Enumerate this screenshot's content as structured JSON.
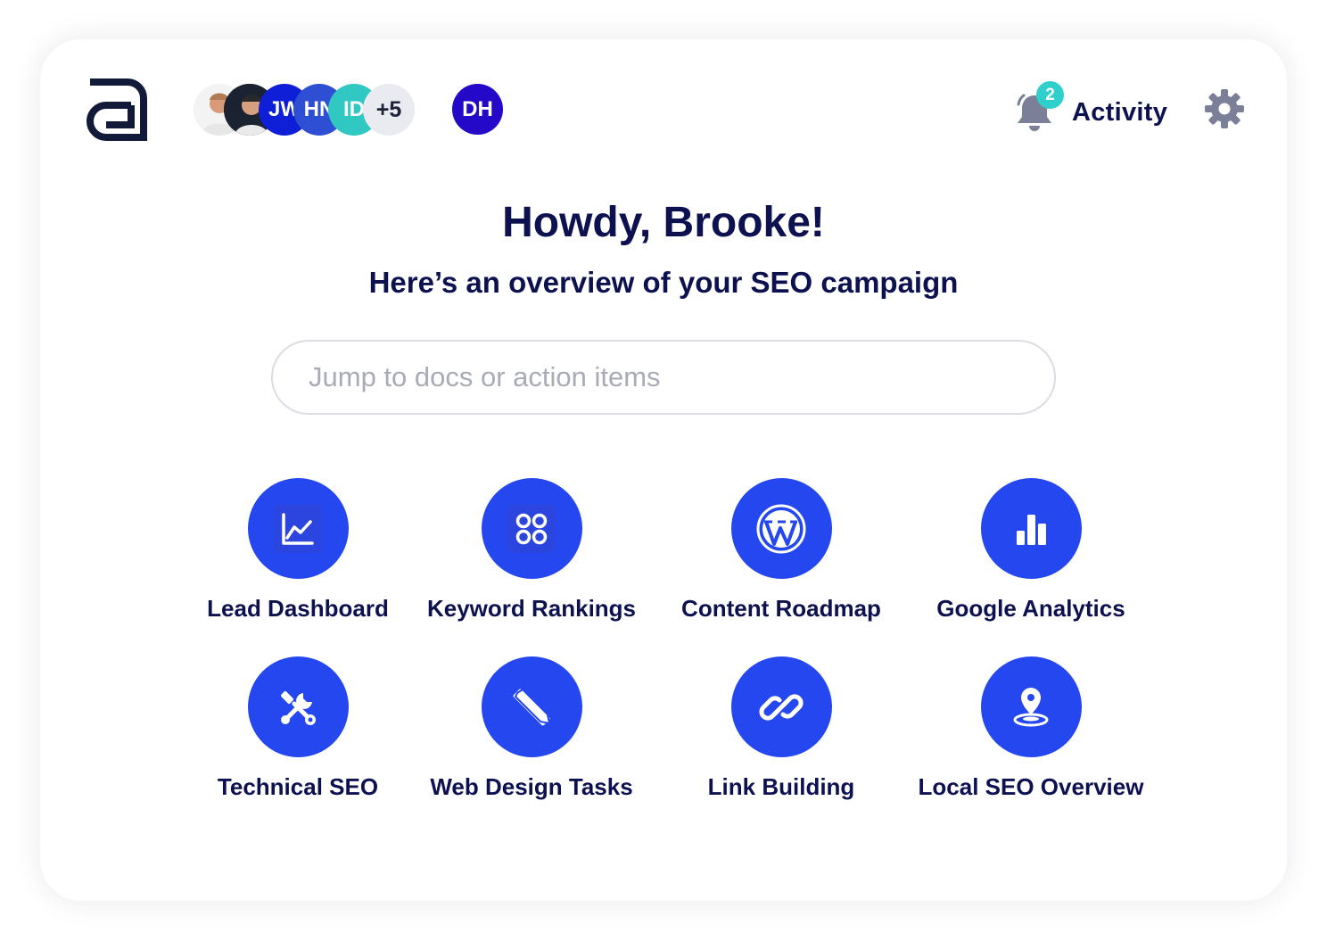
{
  "header": {
    "team_avatars": [
      {
        "initials": "",
        "kind": "photo"
      },
      {
        "initials": "",
        "kind": "photo"
      },
      {
        "initials": "JW",
        "color": "#0f1fd8"
      },
      {
        "initials": "HN",
        "color": "#2e4fd3"
      },
      {
        "initials": "ID",
        "color": "#31c8c4"
      },
      {
        "initials": "+5",
        "color": "#e9ebf0"
      }
    ],
    "current_user": {
      "initials": "DH",
      "color": "#2409c9"
    },
    "activity": {
      "label": "Activity",
      "count": "2"
    }
  },
  "main": {
    "greeting": "Howdy, Brooke!",
    "subtitle": "Here’s an overview of your SEO campaign",
    "search_placeholder": "Jump to docs or action items"
  },
  "tiles": [
    {
      "label": "Lead Dashboard",
      "icon": "line-chart-icon"
    },
    {
      "label": "Keyword Rankings",
      "icon": "grid-circles-icon"
    },
    {
      "label": "Content Roadmap",
      "icon": "wordpress-icon"
    },
    {
      "label": "Google Analytics",
      "icon": "bar-chart-icon"
    },
    {
      "label": "Technical SEO",
      "icon": "tools-icon"
    },
    {
      "label": "Web Design Tasks",
      "icon": "pencil-ruler-icon"
    },
    {
      "label": "Link Building",
      "icon": "link-icon"
    },
    {
      "label": "Local SEO Overview",
      "icon": "map-pin-icon"
    }
  ],
  "colors": {
    "accent": "#2547ef",
    "text": "#0d1150",
    "badge": "#2fd0cc",
    "gear": "#7b7f97"
  }
}
